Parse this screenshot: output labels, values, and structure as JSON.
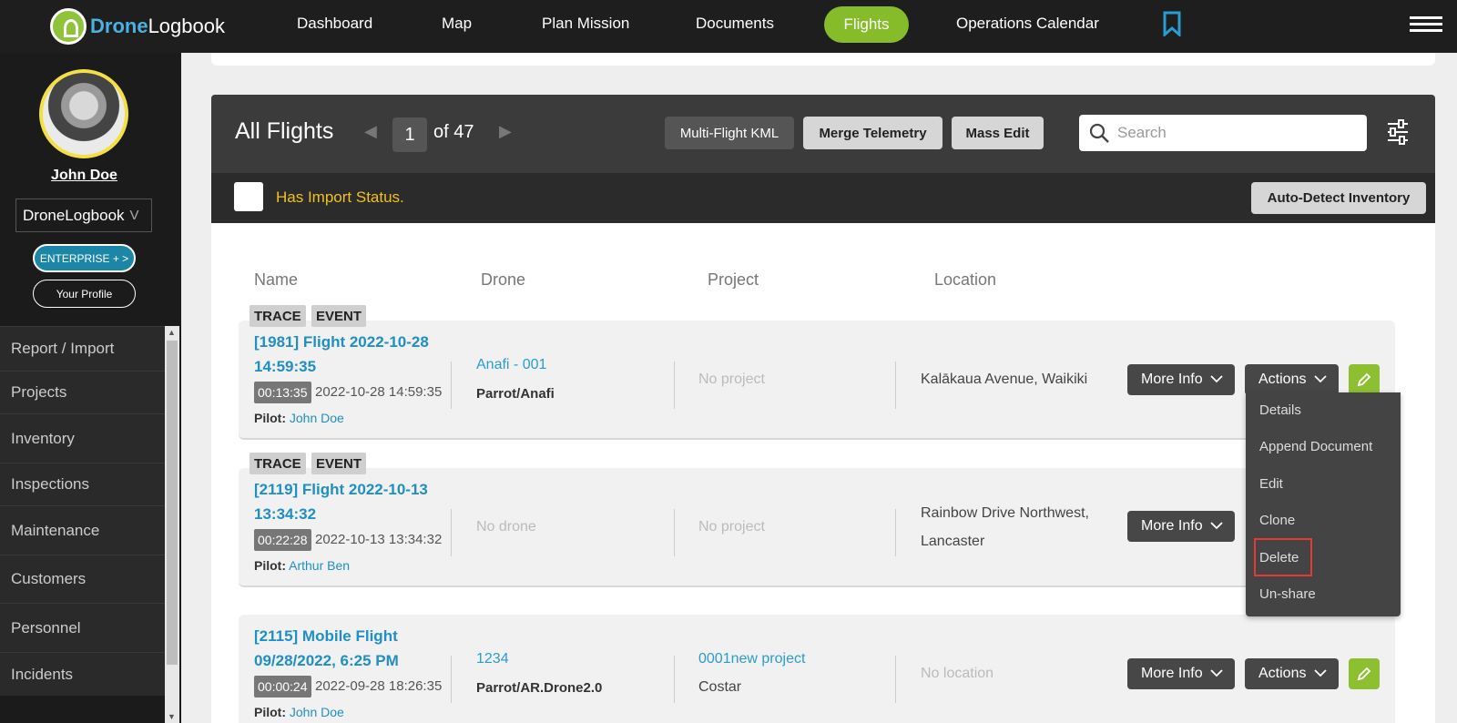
{
  "brand": {
    "name_a": "Drone",
    "name_b": "Logbook"
  },
  "nav": {
    "items": [
      "Dashboard",
      "Map",
      "Plan Mission",
      "Documents",
      "Flights",
      "Operations Calendar"
    ],
    "active": "Flights"
  },
  "sidebar": {
    "user_name": "John Doe",
    "org": "DroneLogbook",
    "org_caret": "V",
    "enterprise_label": "ENTERPRISE + >",
    "profile_label": "Your Profile",
    "menu": [
      "Report / Import",
      "Projects",
      "Inventory",
      "Inspections",
      "Maintenance",
      "Customers",
      "Personnel",
      "Incidents"
    ]
  },
  "panel": {
    "title": "All Flights",
    "page": "1",
    "of": "of 47",
    "btn_kml": "Multi-Flight KML",
    "btn_merge": "Merge Telemetry",
    "btn_mass": "Mass Edit",
    "search_placeholder": "Search",
    "import_status": "Has Import Status.",
    "auto_detect": "Auto-Detect Inventory"
  },
  "columns": [
    "Name",
    "Drone",
    "Project",
    "Location"
  ],
  "tags": {
    "trace": "TRACE",
    "event": "EVENT"
  },
  "flights": [
    {
      "name": "[1981] Flight 2022-10-28 14:59:35",
      "duration": "00:13:35",
      "date": "2022-10-28 14:59:35",
      "pilot_label": "Pilot:",
      "pilot": "John Doe",
      "drone": "Anafi - 001",
      "drone_model": "Parrot/Anafi",
      "project": "No project",
      "location": "Kalākaua Avenue, Waikiki"
    },
    {
      "name": "[2119] Flight 2022-10-13 13:34:32",
      "duration": "00:22:28",
      "date": "2022-10-13 13:34:32",
      "pilot_label": "Pilot:",
      "pilot": "Arthur Ben",
      "drone": "No drone",
      "project": "No project",
      "location": "Rainbow Drive Northwest, Lancaster"
    },
    {
      "name": "[2115] Mobile Flight 09/28/2022, 6:25 PM",
      "duration": "00:00:24",
      "date": "2022-09-28 18:26:35",
      "pilot_label": "Pilot:",
      "pilot": "John Doe",
      "drone": "1234",
      "drone_model": "Parrot/AR.Drone2.0",
      "project": "0001new project",
      "project_sub": "Costar",
      "location": "No location"
    }
  ],
  "row_actions": {
    "more_info": "More Info",
    "actions": "Actions"
  },
  "actions_menu": [
    "Details",
    "Append Document",
    "Edit",
    "Clone",
    "Delete",
    "Un-share"
  ],
  "colors": {
    "accent_green": "#86bb2a",
    "link_blue": "#1f8fc5",
    "import_yellow": "#f2c21b",
    "highlight_red": "#e53935"
  }
}
